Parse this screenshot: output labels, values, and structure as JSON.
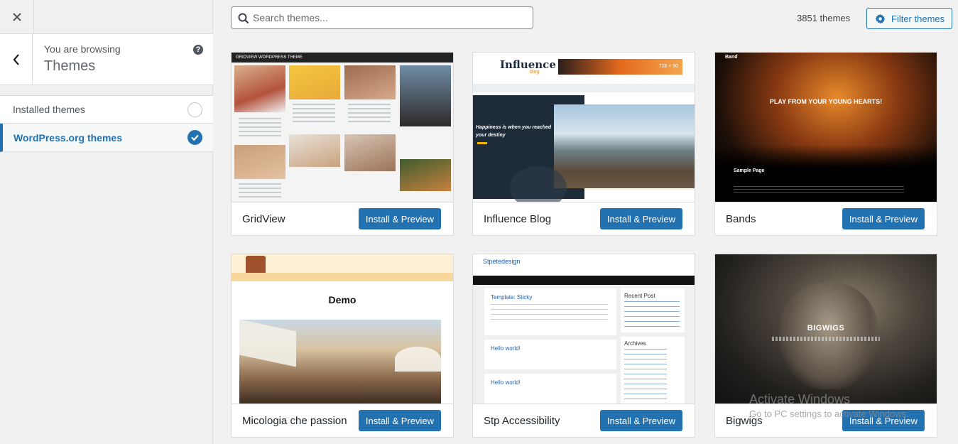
{
  "sidebar": {
    "close_label": "Close",
    "back_label": "Back",
    "browsing_sub": "You are browsing",
    "browsing_title": "Themes",
    "help_label": "?",
    "sources": [
      {
        "label": "Installed themes",
        "selected": false
      },
      {
        "label": "WordPress.org themes",
        "selected": true
      }
    ]
  },
  "toolbar": {
    "search_placeholder": "Search themes...",
    "theme_count": "3851 themes",
    "filter_label": "Filter themes"
  },
  "themes": [
    {
      "name": "GridView",
      "button": "Install & Preview",
      "shot_text": "GRIDVIEW WORDPRESS THEME"
    },
    {
      "name": "Influence Blog",
      "button": "Install & Preview",
      "shot_text": "Influence",
      "shot_sub": "blog",
      "shot_hero": "Happiness is when you reached your destiny",
      "shot_ad": "728 × 90"
    },
    {
      "name": "Bands",
      "button": "Install & Preview",
      "shot_text": "Band",
      "shot_hero": "PLAY FROM YOUR YOUNG HEARTS!",
      "shot_sub": "Sample Page"
    },
    {
      "name": "Micologia che passion",
      "button": "Install & Preview",
      "shot_text": "Demo"
    },
    {
      "name": "Stp Accessibility",
      "button": "Install & Preview",
      "shot_text": "Stpetedesign",
      "shot_p1": "Template: Sticky",
      "shot_p2": "Hello world!",
      "shot_p3": "Hello world!",
      "shot_w1": "Recent Post",
      "shot_w2": "Archives"
    },
    {
      "name": "Bigwigs",
      "button": "Install & Preview",
      "shot_text": "BIGWIGS"
    }
  ],
  "watermark": {
    "line1": "Activate Windows",
    "line2": "Go to PC settings to activate Windows."
  },
  "colors": {
    "accent": "#2271b1",
    "sidebar_bg": "#f0f0f1",
    "page_bg": "#f1f1f1"
  }
}
